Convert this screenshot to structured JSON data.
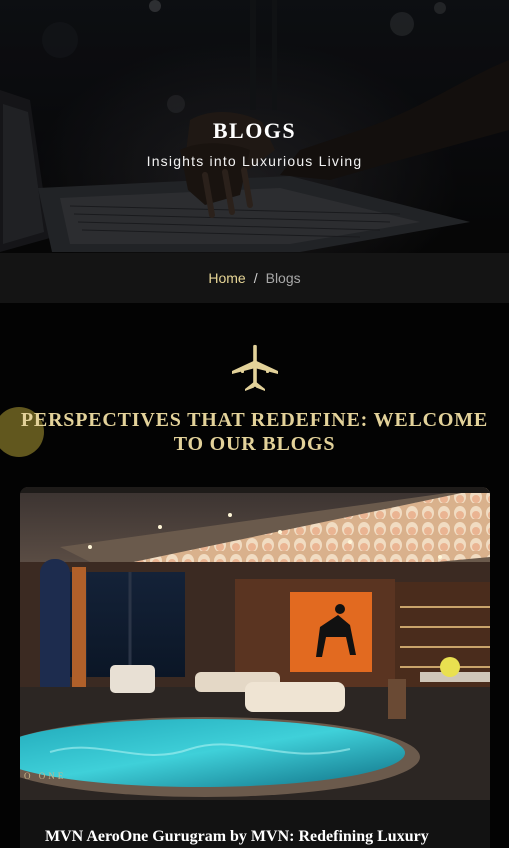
{
  "hero": {
    "title": "BLOGS",
    "subtitle": "Insights into Luxurious Living"
  },
  "breadcrumb": {
    "home": "Home",
    "separator": "/",
    "current": "Blogs"
  },
  "section": {
    "icon": "airplane-icon",
    "heading": "PERSPECTIVES THAT REDEFINE: WELCOME TO OUR BLOGS"
  },
  "posts": [
    {
      "title": "MVN AeroOne Gurugram by MVN: Redefining Luxury",
      "image_watermark": "O ONE"
    }
  ],
  "colors": {
    "gold": "#e3d29a",
    "breadcrumb_bar": "#141414",
    "page_background": "#030303"
  }
}
